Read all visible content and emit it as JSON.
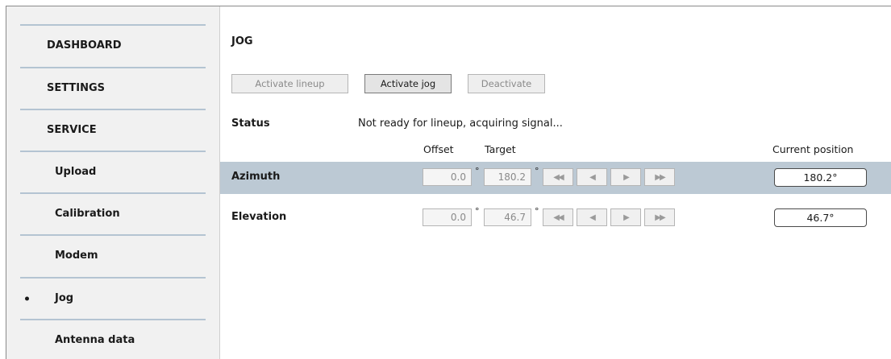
{
  "sidebar": {
    "items": [
      {
        "label": "DASHBOARD",
        "active": false
      },
      {
        "label": "SETTINGS",
        "active": false
      },
      {
        "label": "SERVICE",
        "active": false
      },
      {
        "label": "Upload",
        "active": false
      },
      {
        "label": "Calibration",
        "active": false
      },
      {
        "label": "Modem",
        "active": false
      },
      {
        "label": "Jog",
        "active": true
      },
      {
        "label": "Antenna data",
        "active": false
      }
    ]
  },
  "main": {
    "title": "JOG",
    "buttons": {
      "activate_lineup": "Activate lineup",
      "activate_jog": "Activate jog",
      "deactivate": "Deactivate"
    },
    "status_label": "Status",
    "status_text": "Not ready for lineup, acquiring signal...",
    "columns": {
      "offset": "Offset",
      "target": "Target",
      "current_position": "Current position"
    },
    "degree_symbol": "°",
    "arrows": {
      "fast_left": "◀◀",
      "left": "◀",
      "right": "▶",
      "fast_right": "▶▶"
    },
    "rows": [
      {
        "label": "Azimuth",
        "offset": "0.0",
        "target": "180.2",
        "current": "180.2°"
      },
      {
        "label": "Elevation",
        "offset": "0.0",
        "target": "46.7",
        "current": "46.7°"
      }
    ]
  },
  "colors": {
    "sidebar_bg": "#f1f1f1",
    "nav_divider": "#b4c4d2",
    "row_highlight": "#bcc9d4"
  }
}
